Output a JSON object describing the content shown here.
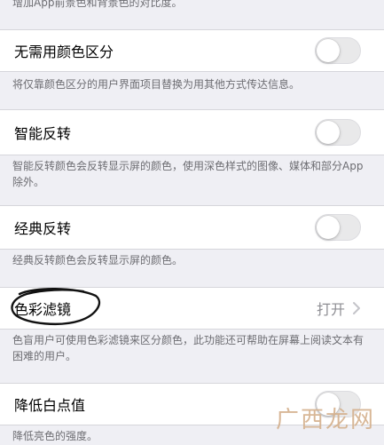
{
  "sections": {
    "top_footer": "增加App前景色和背景色的对比度。",
    "no_color": {
      "label": "无需用颜色区分",
      "footer": "将仅靠颜色区分的用户界面项目替换为用其他方式传达信息。",
      "enabled": false
    },
    "smart_invert": {
      "label": "智能反转",
      "footer": "智能反转颜色会反转显示屏的颜色，使用深色样式的图像、媒体和部分App除外。",
      "enabled": false
    },
    "classic_invert": {
      "label": "经典反转",
      "footer": "经典反转颜色会反转显示屏的颜色。",
      "enabled": false
    },
    "color_filters": {
      "label": "色彩滤镜",
      "value": "打开",
      "footer": "色盲用户可使用色彩滤镜来区分颜色，此功能还可帮助在屏幕上阅读文本有困难的用户。"
    },
    "reduce_white_point": {
      "label": "降低白点值",
      "footer": "降低亮色的强度。",
      "enabled": false
    }
  },
  "watermark": "广西龙网",
  "colors": {
    "background": "#efeff4",
    "toggle_off": "#e9e9ea",
    "footer_text": "#6d6d72",
    "value_text": "#8e8e93",
    "watermark": "#d4b08c"
  }
}
